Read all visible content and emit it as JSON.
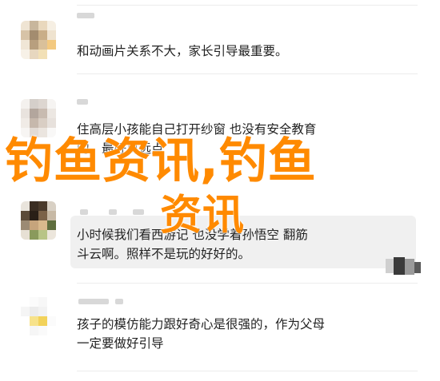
{
  "comments": [
    {
      "text_line1": "和动画片关系不大，家长引导最重要。",
      "text_line2": ""
    },
    {
      "text_line1": "住高层小孩能自己打开纱窗 也没有安全教育",
      "text_line2": "的，最好离远点"
    },
    {
      "text_line1": "小时候我们看西游记 也没学着孙悟空  翻筋",
      "text_line2": "斗云啊。照样不是玩的好好的。"
    },
    {
      "text_line1": "孩子的模仿能力跟好奇心是很强的，作为父母",
      "text_line2": "一定要做好引导"
    }
  ],
  "watermark": {
    "line1": "钓鱼资讯,钓鱼",
    "line2": "资讯"
  },
  "colors": {
    "watermark": "#ff8a00",
    "text": "#222222",
    "bubble": "#f0f0f0"
  }
}
